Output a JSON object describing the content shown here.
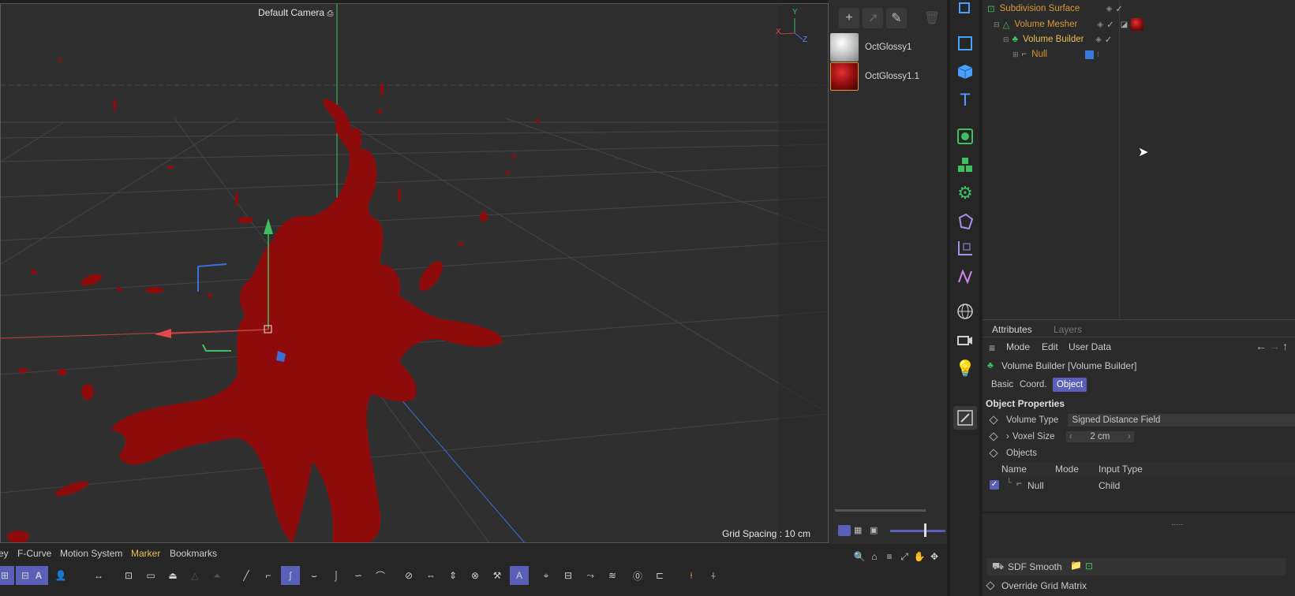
{
  "viewport": {
    "camera_label": "Default Camera",
    "grid_spacing": "Grid Spacing : 10 cm",
    "axis_x": "X",
    "axis_y": "Y",
    "axis_z": "Z"
  },
  "materials": {
    "items": [
      {
        "name": "OctGlossy1",
        "color": "#e6e6e6"
      },
      {
        "name": "OctGlossy1.1",
        "color": "#8a0c0c"
      }
    ],
    "buttons": [
      "add-icon",
      "arrow-icon",
      "eyedropper-icon",
      "trash-icon"
    ]
  },
  "object_manager": {
    "objects": [
      {
        "name": "Subdivision Surface",
        "color": "#d89a3a"
      },
      {
        "name": "Volume Mesher",
        "color": "#d89a3a"
      },
      {
        "name": "Volume Builder",
        "color": "#e0b04a"
      },
      {
        "name": "Null",
        "color": "#d89a3a"
      }
    ]
  },
  "attributes": {
    "tab_attributes": "Attributes",
    "tab_layers": "Layers",
    "menu_mode": "Mode",
    "menu_edit": "Edit",
    "menu_user_data": "User Data",
    "object_title": "Volume Builder [Volume Builder]",
    "tabs": {
      "basic": "Basic",
      "coord": "Coord.",
      "object": "Object"
    },
    "section_title": "Object Properties",
    "volume_type_label": "Volume Type",
    "volume_type_value": "Signed Distance Field",
    "voxel_size_label": "Voxel Size",
    "voxel_size_value": "2 cm",
    "objects_label": "Objects",
    "table_headers": {
      "name": "Name",
      "mode": "Mode",
      "input_type": "Input Type"
    },
    "table_rows": [
      {
        "name": "Null",
        "mode": "",
        "input_type": "Child",
        "checked": true
      }
    ]
  },
  "bottom_menu": {
    "items": [
      "ey",
      "F-Curve",
      "Motion System",
      "Marker",
      "Bookmarks"
    ],
    "active": "Marker"
  },
  "sdf_bar": {
    "label": "SDF Smooth",
    "override_label": "Override Grid Matrix"
  },
  "colors": {
    "accent": "#5a5fb8",
    "model_red": "#8e0b0b",
    "orange_text": "#d89a3a"
  }
}
